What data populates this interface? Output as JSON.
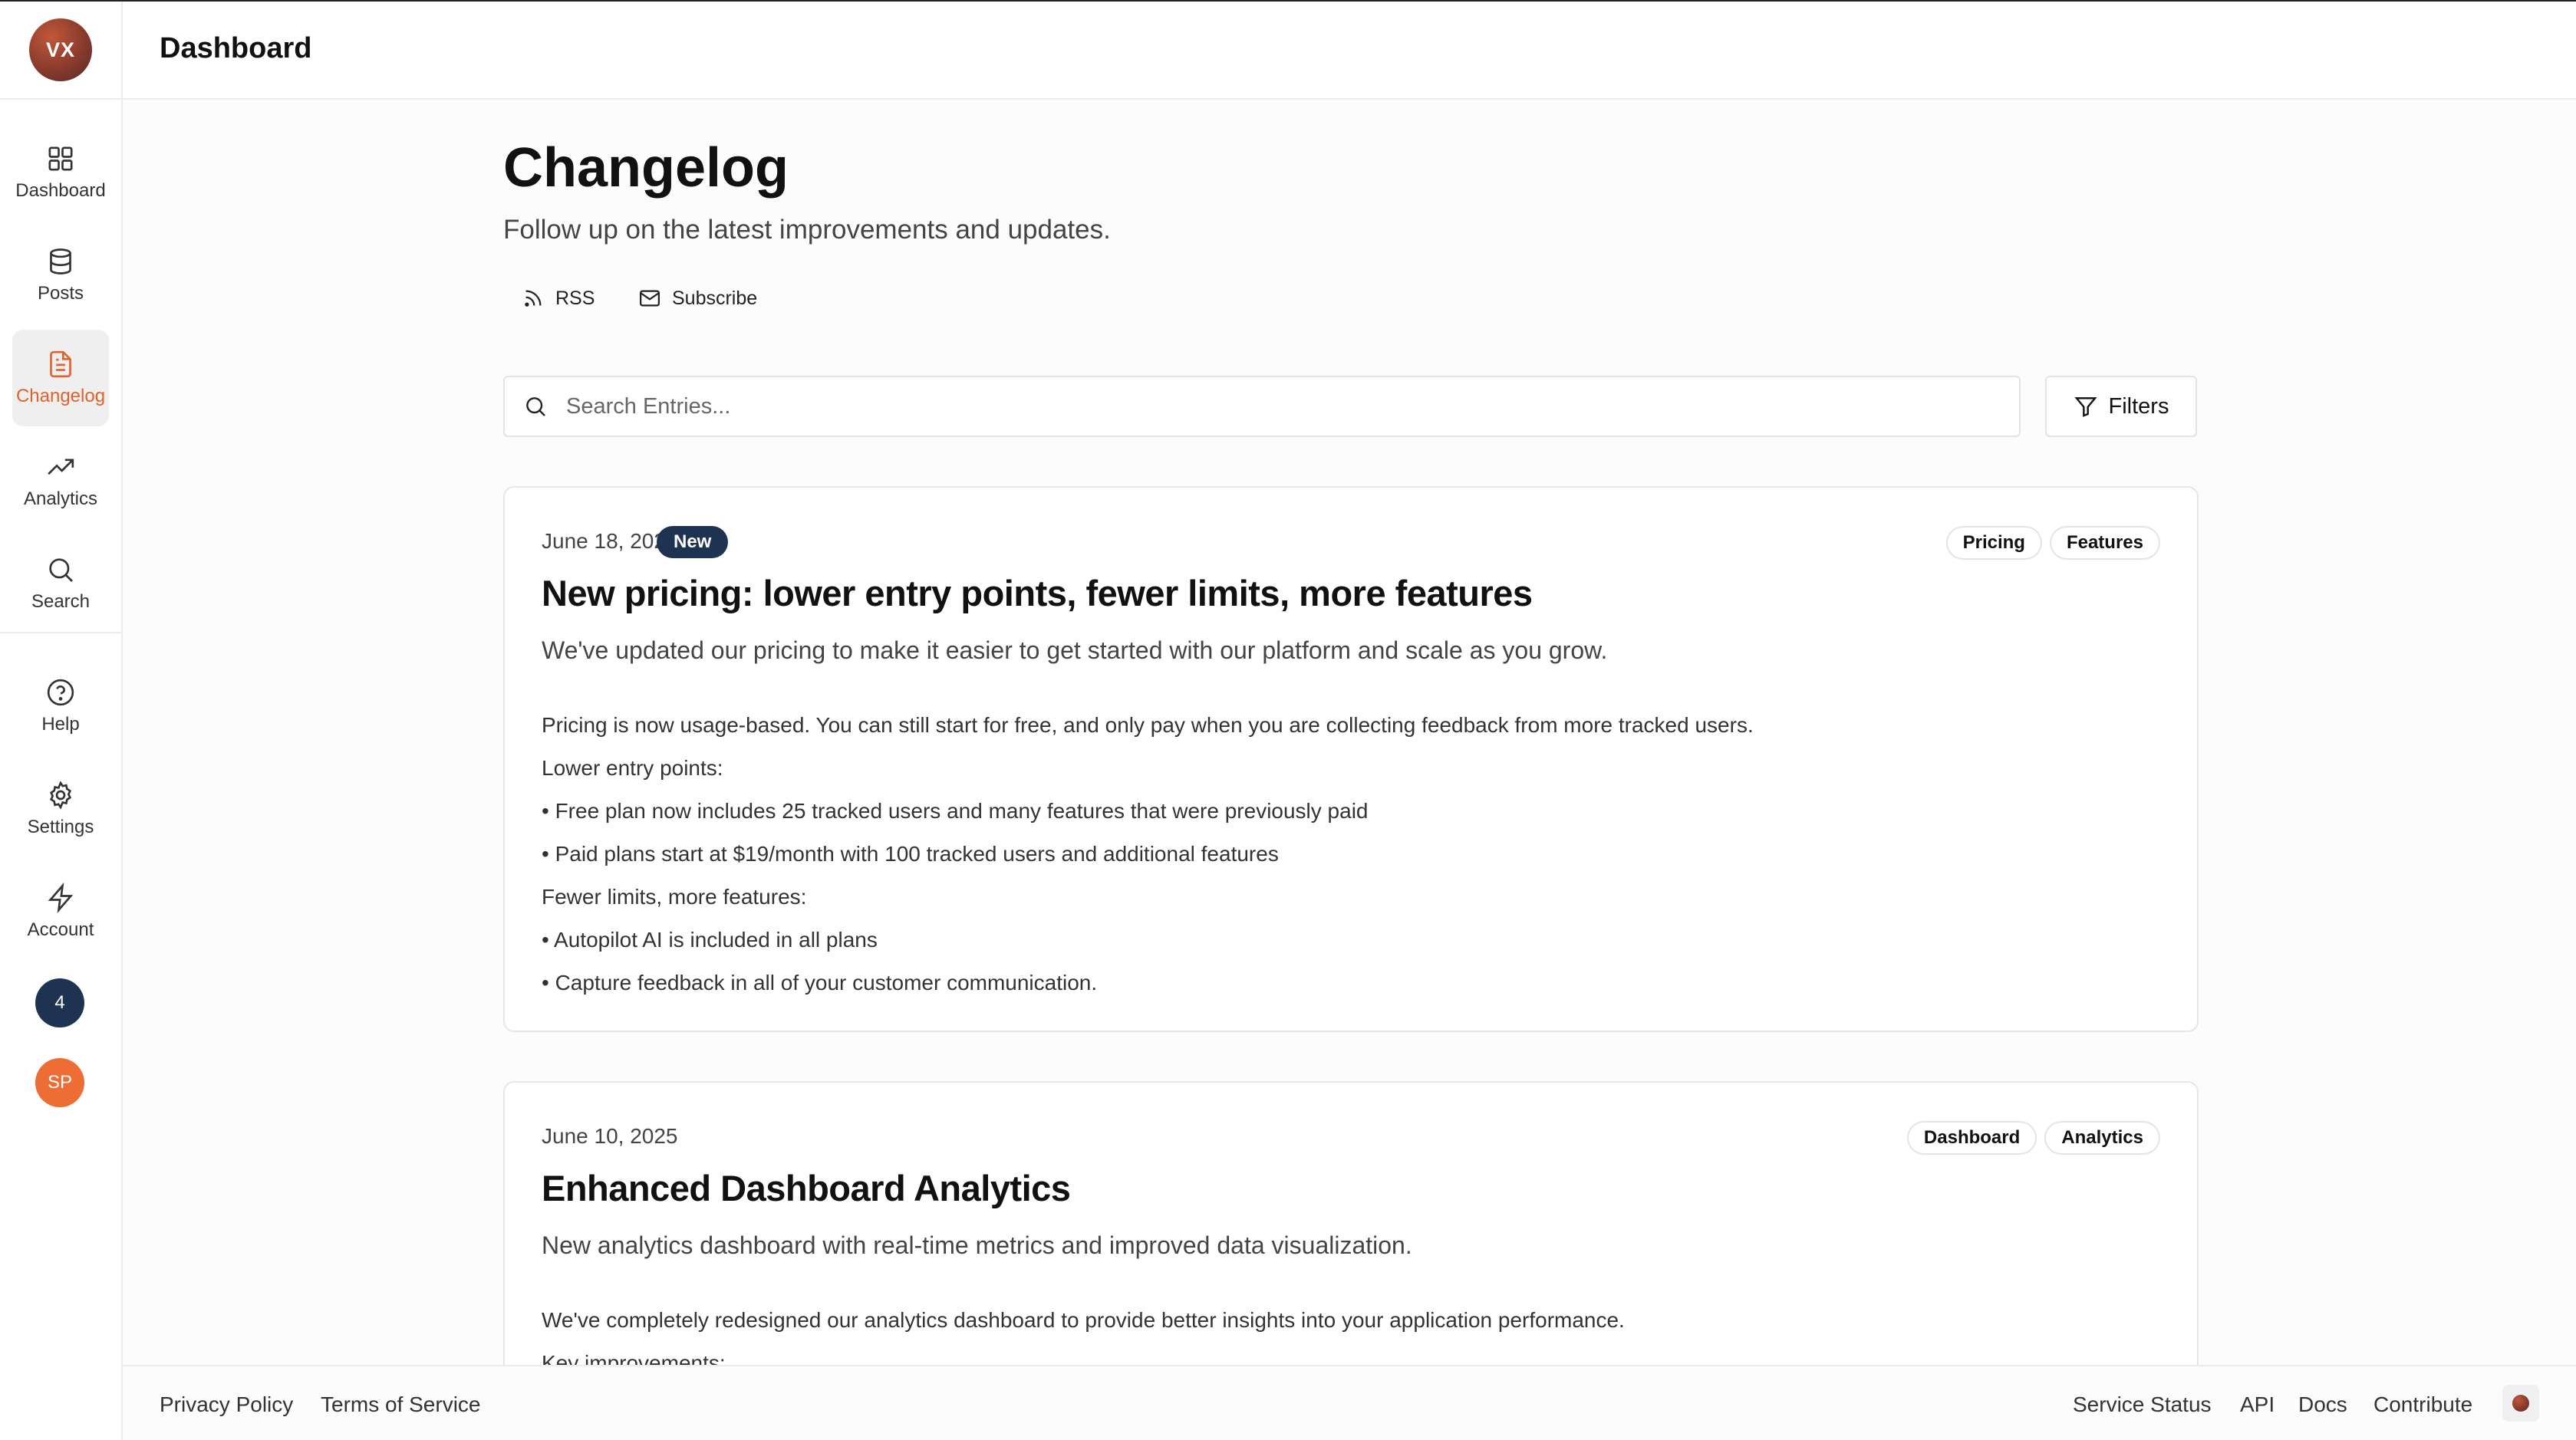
{
  "sidebar": {
    "avatar_initials": "VX",
    "items": [
      {
        "label": "Dashboard",
        "icon": "grid-icon"
      },
      {
        "label": "Posts",
        "icon": "database-icon"
      },
      {
        "label": "Changelog",
        "icon": "document-icon",
        "active": true
      },
      {
        "label": "Analytics",
        "icon": "trending-up-icon"
      },
      {
        "label": "Search",
        "icon": "search-icon"
      }
    ],
    "bottom_items": [
      {
        "label": "Help",
        "icon": "help-circle-icon"
      },
      {
        "label": "Settings",
        "icon": "gear-icon"
      },
      {
        "label": "Account",
        "icon": "lightning-icon"
      }
    ],
    "notification_count": "4",
    "user_initials": "SP"
  },
  "header": {
    "title": "Dashboard"
  },
  "main": {
    "title": "Changelog",
    "subtitle": "Follow up on the latest improvements and updates.",
    "rss_label": "RSS",
    "subscribe_label": "Subscribe",
    "search_placeholder": "Search Entries...",
    "filters_label": "Filters",
    "entries": [
      {
        "date": "June 18, 2025",
        "badge": "New",
        "tags": [
          "Pricing",
          "Features"
        ],
        "title": "New pricing: lower entry points, fewer limits, more features",
        "summary": "We've updated our pricing to make it easier to get started with our platform and scale as you grow.",
        "body": [
          "Pricing is now usage-based. You can still start for free, and only pay when you are collecting feedback from more tracked users.",
          "Lower entry points:",
          "• Free plan now includes 25 tracked users and many features that were previously paid",
          "• Paid plans start at $19/month with 100 tracked users and additional features",
          "Fewer limits, more features:",
          "• Autopilot AI is included in all plans",
          "• Capture feedback in all of your customer communication."
        ]
      },
      {
        "date": "June 10, 2025",
        "tags": [
          "Dashboard",
          "Analytics"
        ],
        "title": "Enhanced Dashboard Analytics",
        "summary": "New analytics dashboard with real-time metrics and improved data visualization.",
        "body": [
          "We've completely redesigned our analytics dashboard to provide better insights into your application performance.",
          "Key improvements:"
        ]
      }
    ]
  },
  "footer": {
    "left_links": [
      "Privacy Policy",
      "Terms of Service"
    ],
    "right_links": [
      "Service Status",
      "API",
      "Docs",
      "Contribute"
    ]
  },
  "colors": {
    "accent": "#e0632e",
    "badge_navy": "#1e3352",
    "user_avatar": "#ee6d35"
  }
}
